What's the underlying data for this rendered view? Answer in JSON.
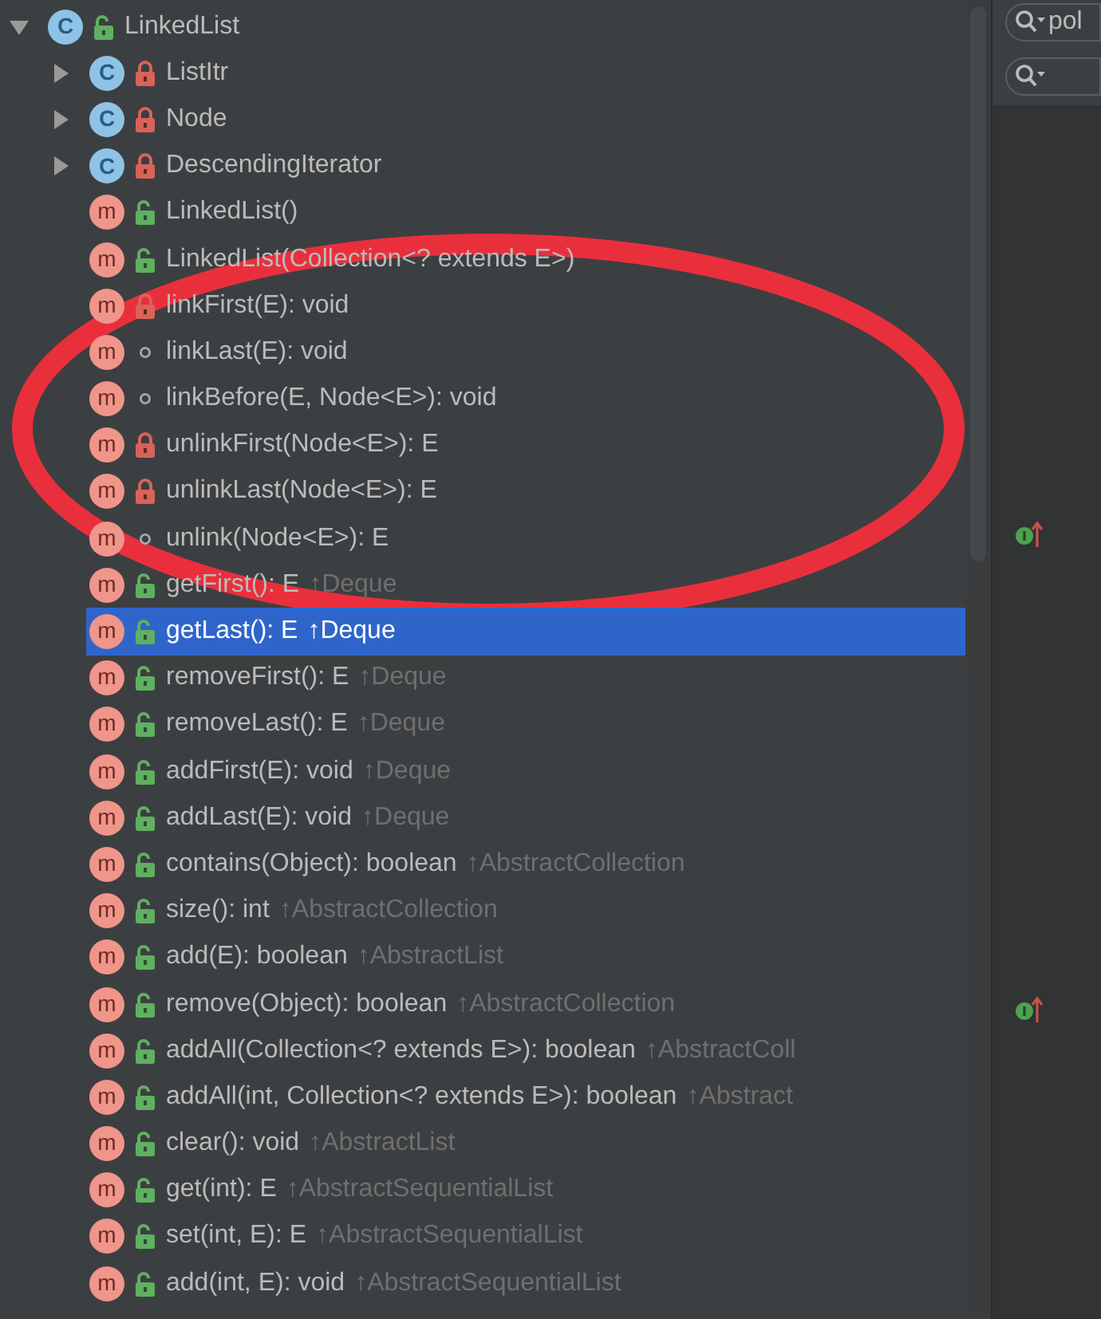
{
  "tree": [
    {
      "kind": "class",
      "badge": "C",
      "public": true,
      "private": false,
      "name": "LinkedList",
      "expanded": true,
      "selected": false,
      "children": [
        {
          "kind": "class",
          "badge": "C",
          "public": false,
          "private": true,
          "name": "ListItr",
          "expanded": false,
          "selected": false
        },
        {
          "kind": "class",
          "badge": "C",
          "public": false,
          "private": true,
          "name": "Node",
          "expanded": false,
          "selected": false
        },
        {
          "kind": "class",
          "badge": "C",
          "public": false,
          "private": true,
          "name": "DescendingIterator",
          "expanded": false,
          "selected": false
        },
        {
          "kind": "method",
          "badge": "m",
          "public": true,
          "private": false,
          "name": "LinkedList()",
          "selected": false
        },
        {
          "kind": "method",
          "badge": "m",
          "public": true,
          "private": false,
          "name": "LinkedList(Collection<? extends E>)",
          "selected": false
        },
        {
          "kind": "method",
          "badge": "m",
          "public": false,
          "private": true,
          "name": "linkFirst(E): void",
          "selected": false
        },
        {
          "kind": "method",
          "badge": "m",
          "public": false,
          "private": false,
          "name": "linkLast(E): void",
          "selected": false
        },
        {
          "kind": "method",
          "badge": "m",
          "public": false,
          "private": false,
          "name": "linkBefore(E, Node<E>): void",
          "selected": false
        },
        {
          "kind": "method",
          "badge": "m",
          "public": false,
          "private": true,
          "name": "unlinkFirst(Node<E>): E",
          "selected": false
        },
        {
          "kind": "method",
          "badge": "m",
          "public": false,
          "private": true,
          "name": "unlinkLast(Node<E>): E",
          "selected": false
        },
        {
          "kind": "method",
          "badge": "m",
          "public": false,
          "private": false,
          "name": "unlink(Node<E>): E",
          "selected": false
        },
        {
          "kind": "method",
          "badge": "m",
          "public": true,
          "private": false,
          "name": "getFirst(): E",
          "inherited": "↑Deque",
          "selected": false
        },
        {
          "kind": "method",
          "badge": "m",
          "public": true,
          "private": false,
          "name": "getLast(): E",
          "inherited": "↑Deque",
          "selected": true
        },
        {
          "kind": "method",
          "badge": "m",
          "public": true,
          "private": false,
          "name": "removeFirst(): E",
          "inherited": "↑Deque",
          "selected": false
        },
        {
          "kind": "method",
          "badge": "m",
          "public": true,
          "private": false,
          "name": "removeLast(): E",
          "inherited": "↑Deque",
          "selected": false
        },
        {
          "kind": "method",
          "badge": "m",
          "public": true,
          "private": false,
          "name": "addFirst(E): void",
          "inherited": "↑Deque",
          "selected": false
        },
        {
          "kind": "method",
          "badge": "m",
          "public": true,
          "private": false,
          "name": "addLast(E): void",
          "inherited": "↑Deque",
          "selected": false
        },
        {
          "kind": "method",
          "badge": "m",
          "public": true,
          "private": false,
          "name": "contains(Object): boolean",
          "inherited": "↑AbstractCollection",
          "selected": false
        },
        {
          "kind": "method",
          "badge": "m",
          "public": true,
          "private": false,
          "name": "size(): int",
          "inherited": "↑AbstractCollection",
          "selected": false
        },
        {
          "kind": "method",
          "badge": "m",
          "public": true,
          "private": false,
          "name": "add(E): boolean",
          "inherited": "↑AbstractList",
          "selected": false
        },
        {
          "kind": "method",
          "badge": "m",
          "public": true,
          "private": false,
          "name": "remove(Object): boolean",
          "inherited": "↑AbstractCollection",
          "selected": false
        },
        {
          "kind": "method",
          "badge": "m",
          "public": true,
          "private": false,
          "name": "addAll(Collection<? extends E>): boolean",
          "inherited": "↑AbstractColl",
          "selected": false
        },
        {
          "kind": "method",
          "badge": "m",
          "public": true,
          "private": false,
          "name": "addAll(int, Collection<? extends E>): boolean",
          "inherited": "↑Abstract",
          "selected": false
        },
        {
          "kind": "method",
          "badge": "m",
          "public": true,
          "private": false,
          "name": "clear(): void",
          "inherited": "↑AbstractList",
          "selected": false
        },
        {
          "kind": "method",
          "badge": "m",
          "public": true,
          "private": false,
          "name": "get(int): E",
          "inherited": "↑AbstractSequentialList",
          "selected": false
        },
        {
          "kind": "method",
          "badge": "m",
          "public": true,
          "private": false,
          "name": "set(int, E): E",
          "inherited": "↑AbstractSequentialList",
          "selected": false
        },
        {
          "kind": "method",
          "badge": "m",
          "public": true,
          "private": false,
          "name": "add(int, E): void",
          "inherited": "↑AbstractSequentialList",
          "selected": false
        }
      ]
    }
  ],
  "search_field": {
    "value": "pol"
  }
}
